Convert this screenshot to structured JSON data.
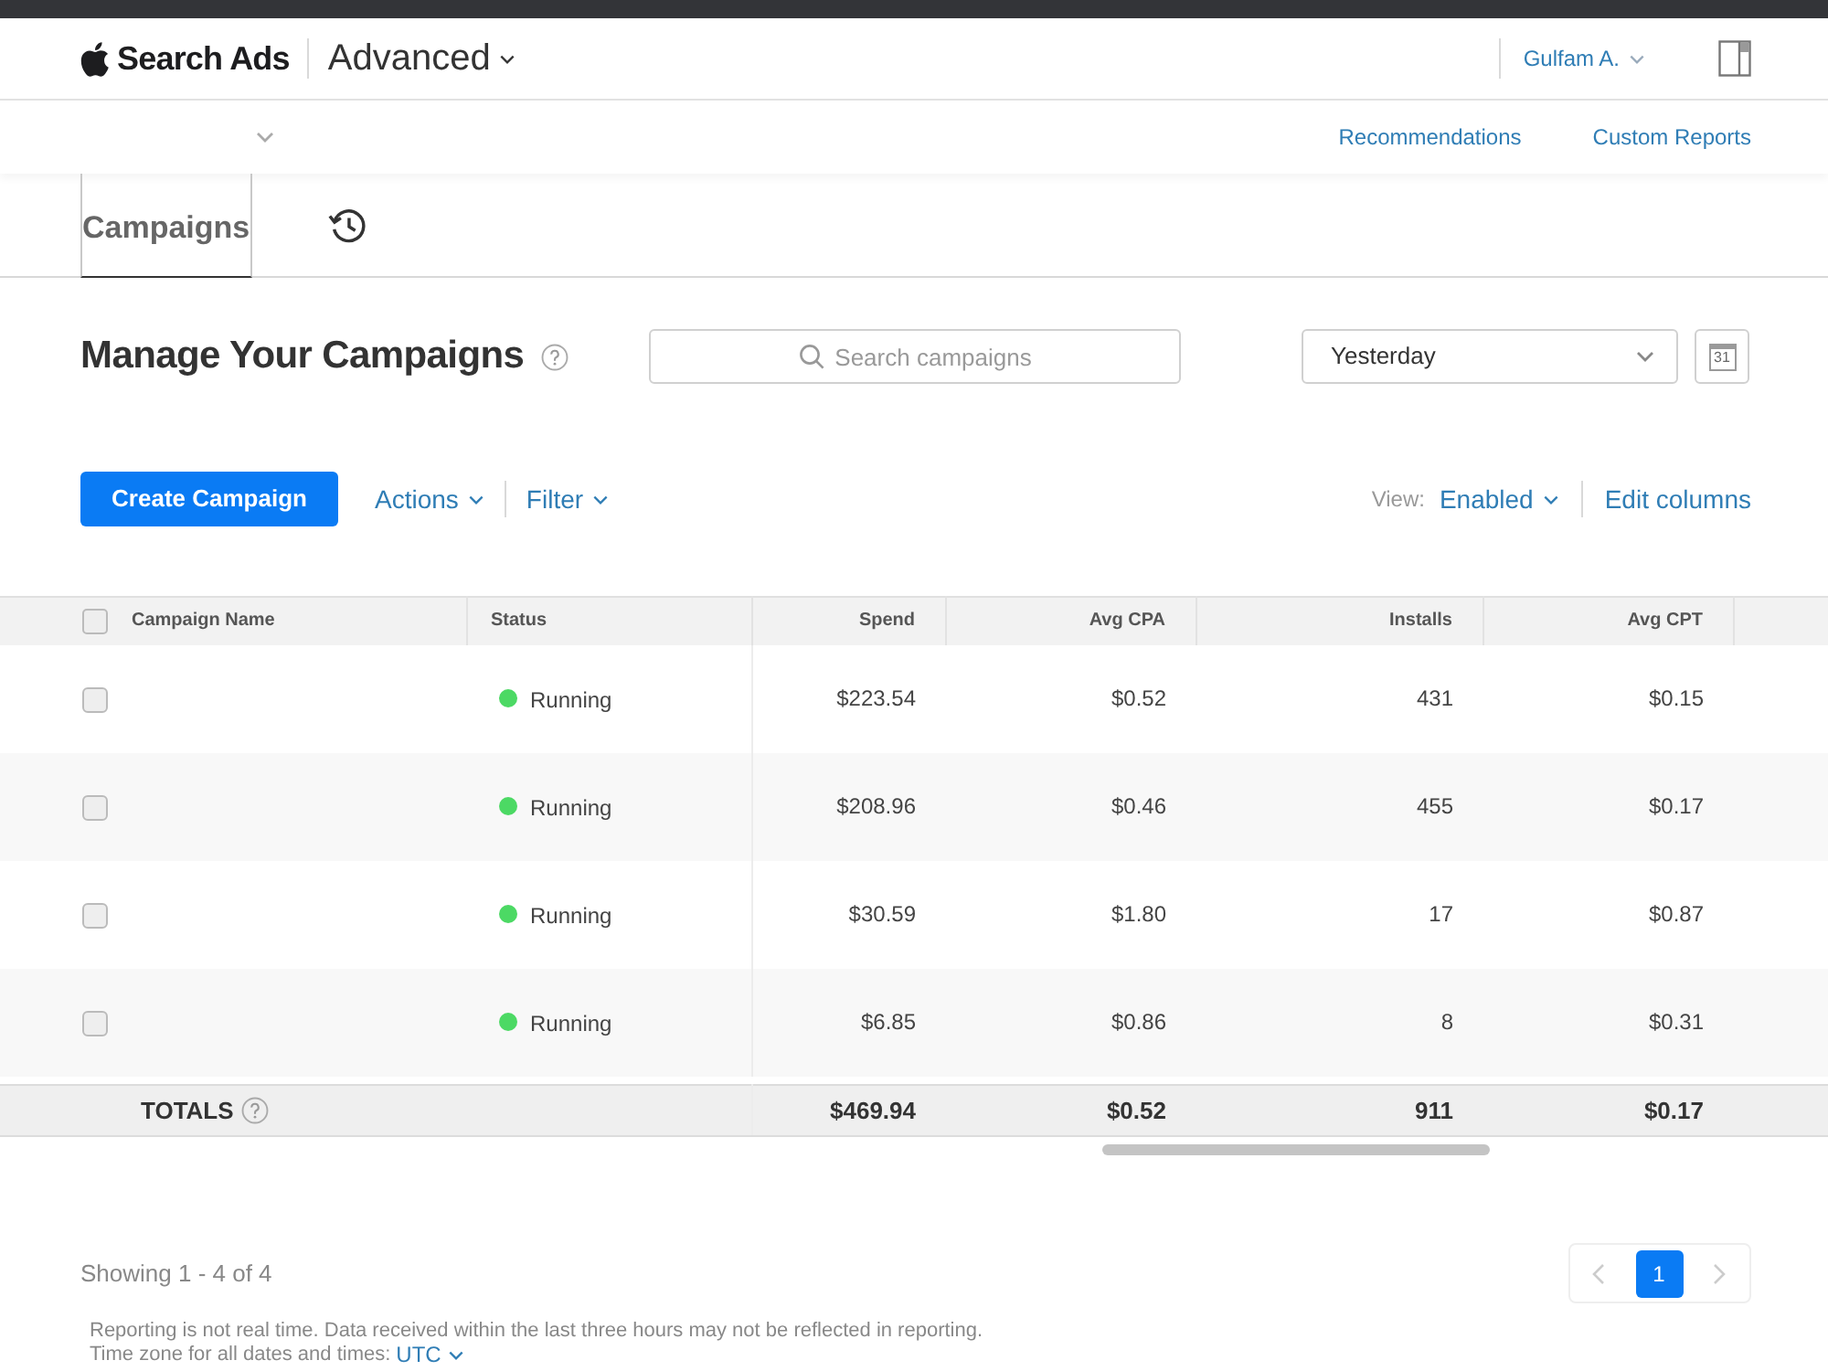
{
  "header": {
    "brand": "Search Ads",
    "product_menu": "Advanced",
    "user_menu": "Gulfam A."
  },
  "subnav": {
    "links": [
      "Recommendations",
      "Custom Reports"
    ]
  },
  "tabs": [
    {
      "kind": "label",
      "label": "Campaigns",
      "selected": true
    },
    {
      "kind": "history",
      "selected": false
    }
  ],
  "title": "Manage Your Campaigns",
  "search": {
    "placeholder": "Search campaigns"
  },
  "date_range": {
    "value": "Yesterday"
  },
  "calendar_button": {
    "label": "31"
  },
  "toolbar": {
    "create_button": "Create Campaign",
    "menus": [
      "Actions",
      "Filter"
    ],
    "view_label": "View:",
    "view_value": "Enabled",
    "edit_columns": "Edit columns"
  },
  "table": {
    "select_all_checked": false,
    "columns": [
      "Campaign Name",
      "Status",
      "Spend",
      "Avg CPA",
      "Installs",
      "Avg CPT"
    ],
    "rows": [
      {
        "checked": false,
        "status": {
          "text": "Running",
          "color": "#4cd964"
        },
        "spend": "$223.54",
        "avg_cpa": "$0.52",
        "installs": "431",
        "avg_cpt": "$0.15"
      },
      {
        "checked": false,
        "status": {
          "text": "Running",
          "color": "#4cd964"
        },
        "spend": "$208.96",
        "avg_cpa": "$0.46",
        "installs": "455",
        "avg_cpt": "$0.17"
      },
      {
        "checked": false,
        "status": {
          "text": "Running",
          "color": "#4cd964"
        },
        "spend": "$30.59",
        "avg_cpa": "$1.80",
        "installs": "17",
        "avg_cpt": "$0.87"
      },
      {
        "checked": false,
        "status": {
          "text": "Running",
          "color": "#4cd964"
        },
        "spend": "$6.85",
        "avg_cpa": "$0.86",
        "installs": "8",
        "avg_cpt": "$0.31"
      }
    ],
    "totals": {
      "label": "TOTALS",
      "spend": "$469.94",
      "avg_cpa": "$0.52",
      "installs": "911",
      "avg_cpt": "$0.17"
    }
  },
  "pagination": {
    "summary": "Showing 1 - 4 of 4",
    "prev_disabled": true,
    "next_disabled": true,
    "pages": [
      {
        "label": "1",
        "selected": true
      }
    ]
  },
  "notes": {
    "text": "Reporting is not real time. Data received within the last three hours may not be reflected in reporting.",
    "timezone_label": "Time zone for all dates and times:",
    "timezone_value": "UTC"
  }
}
